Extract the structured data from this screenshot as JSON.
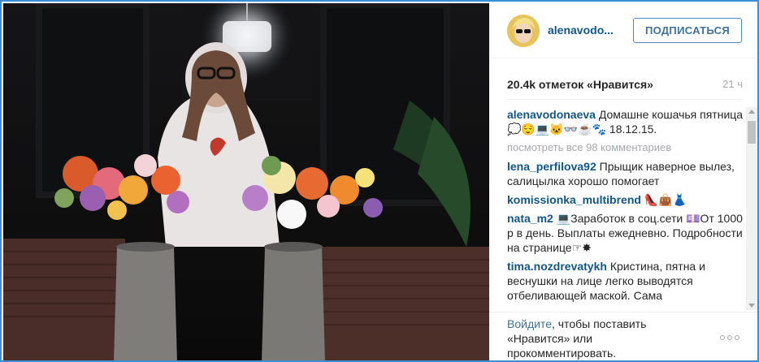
{
  "post": {
    "username": "alenavodo...",
    "follow_label": "ПОДПИСАТЬСЯ",
    "likes": "20.4k отметок «Нравится»",
    "timestamp": "21 ч"
  },
  "caption": {
    "user": "alenavodonaeva",
    "text": "Домашне кошачья пятница 💭😌💻🐱👓☕🐾 18.12.15."
  },
  "view_all_comments": "посмотреть все 98 комментариев",
  "comments": [
    {
      "user": "lena_perfilova92",
      "text": "Прыщик наверное вылез, салицылка хорошо помогает"
    },
    {
      "user": "komissionka_multibrend",
      "text": "👠👜👗"
    },
    {
      "user": "nata_m2",
      "text": "💻Заработок в соц.сети 💷От 1000 р в день. Выплаты ежедневно. Подробности на странице☞✸"
    },
    {
      "user": "tima.nozdrevatykh",
      "text": "Кристина, пятна и веснушки на лице легко выводятся отбеливающей маской. Сама"
    }
  ],
  "footer": {
    "login_link": "Войдите",
    "login_rest": ", чтобы поставить «Нравится» или прокомментировать."
  },
  "icons": {
    "more": "more-options-icon",
    "avatar": "avatar"
  },
  "colors": {
    "username_blue": "#125688",
    "follow_blue": "#3f729b",
    "muted_grey": "#a5a7aa",
    "frame_blue": "#3a8fd6"
  }
}
